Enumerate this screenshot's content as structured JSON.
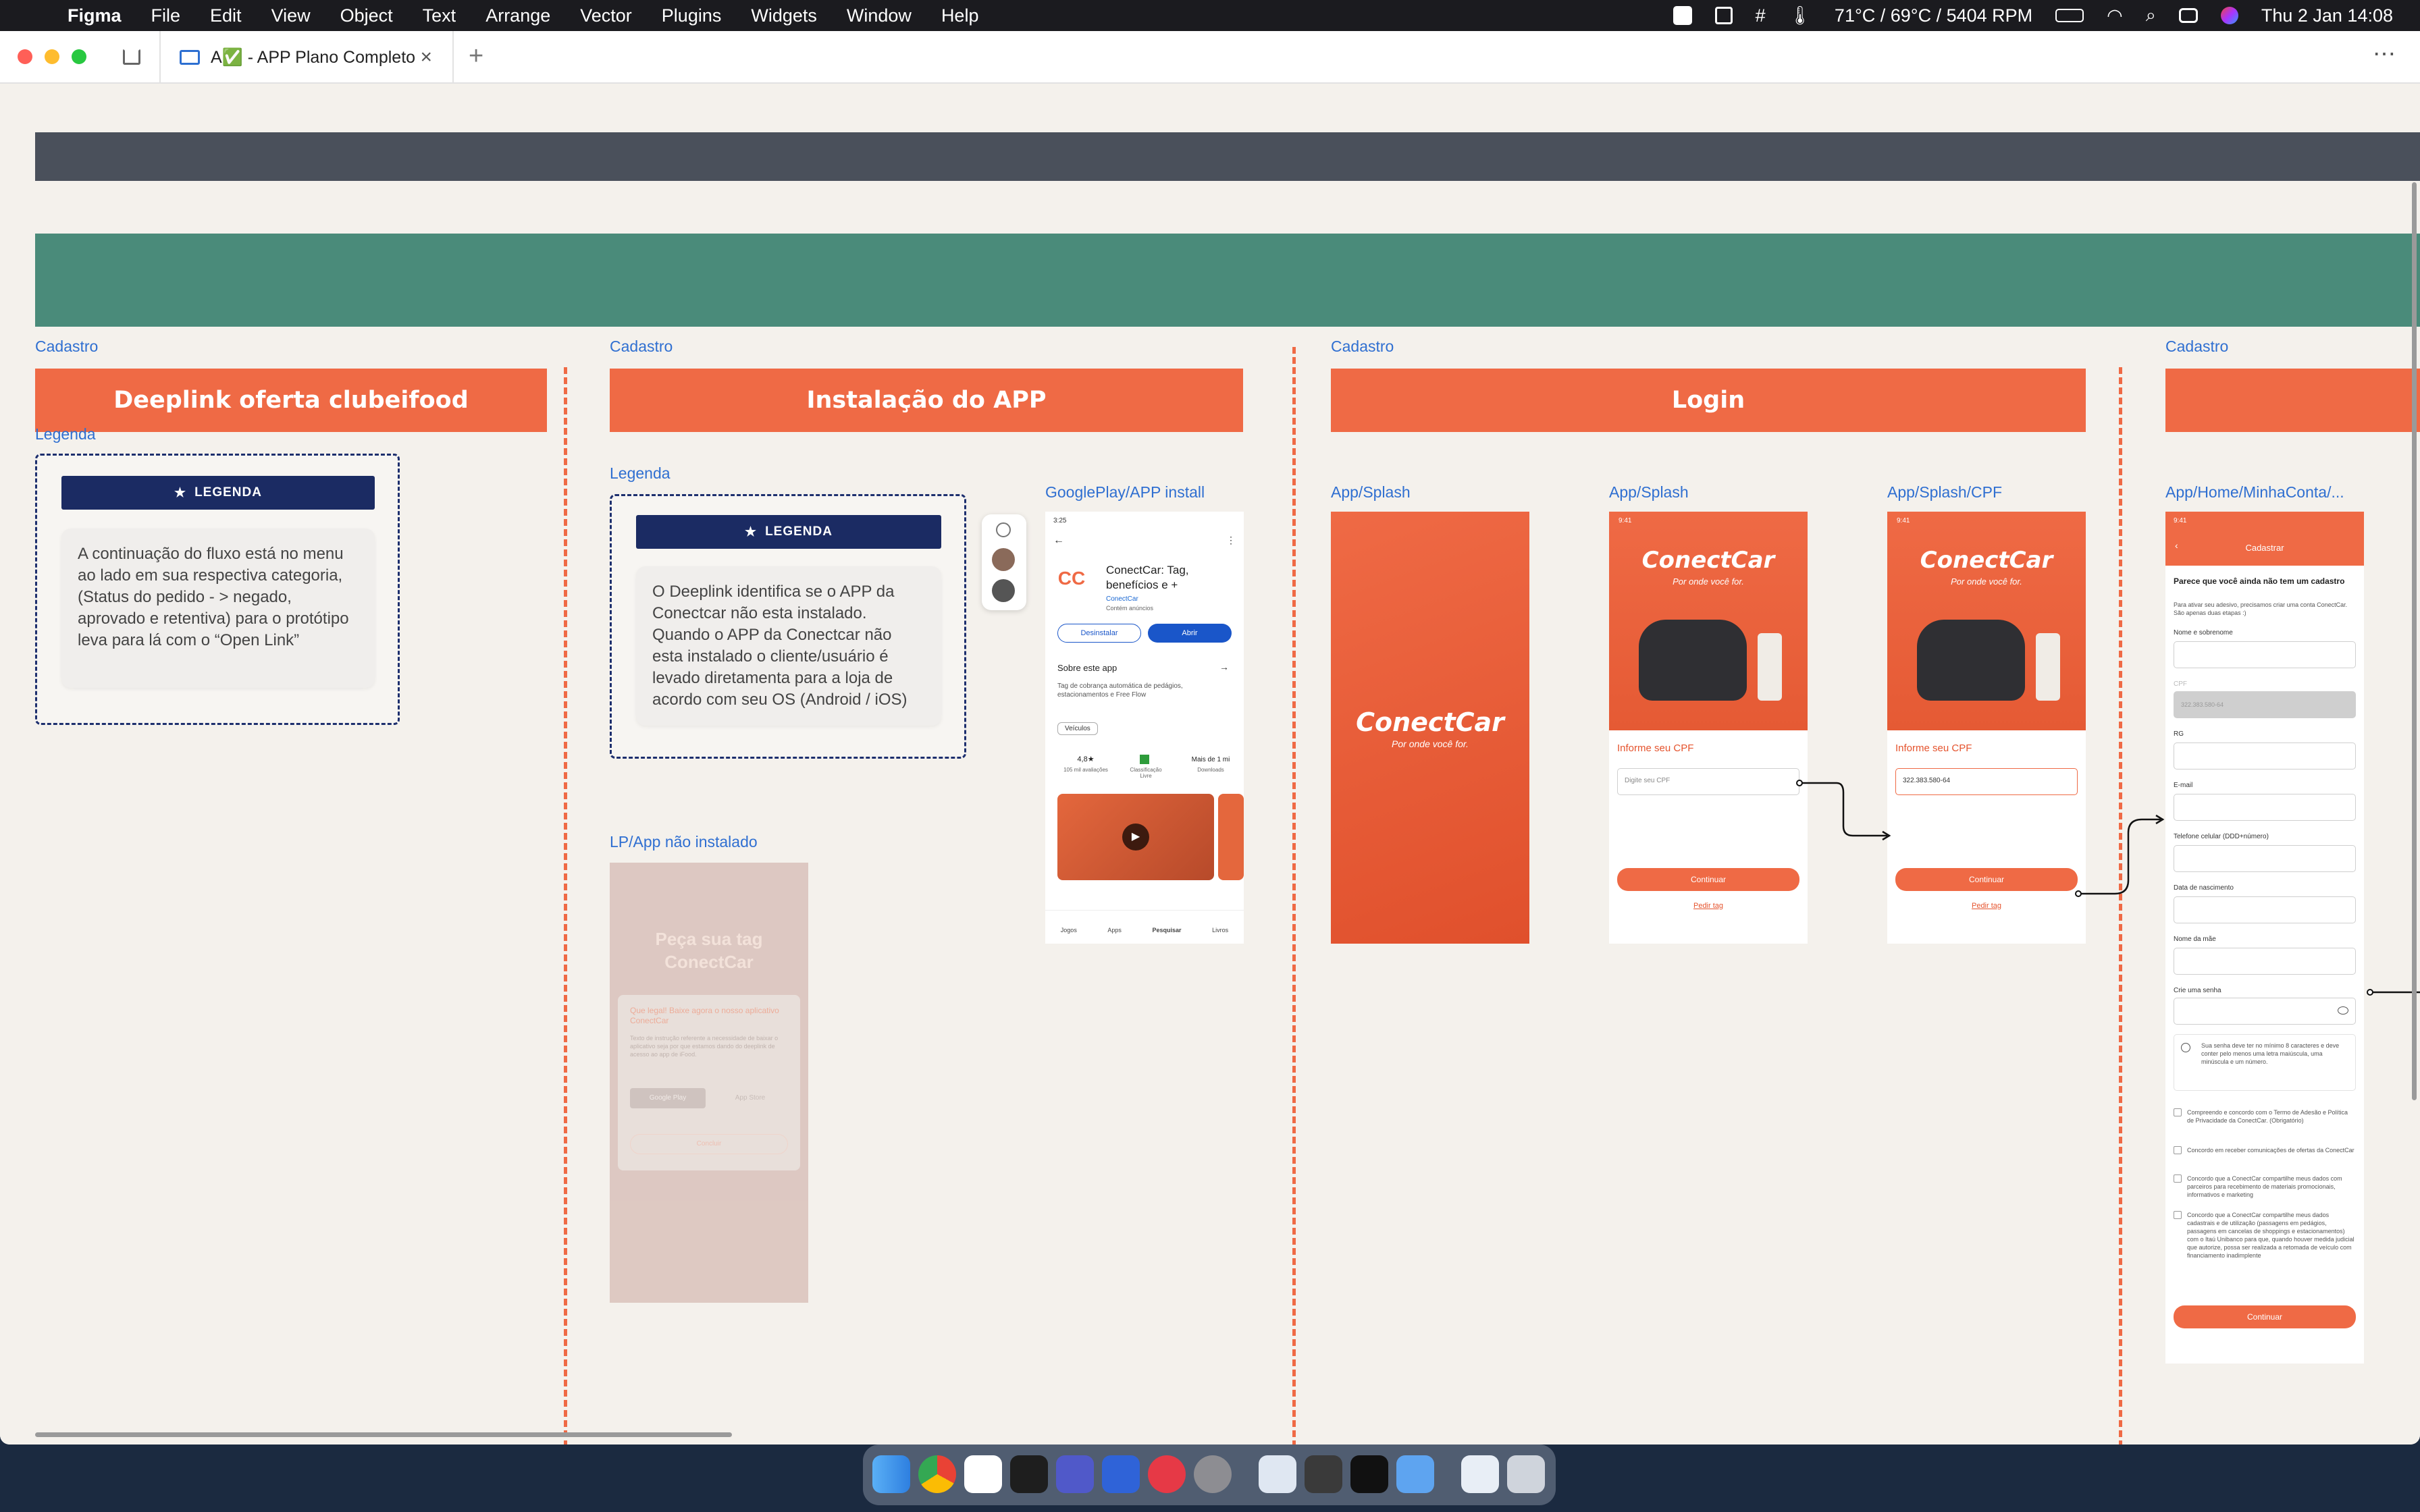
{
  "menubar": {
    "app": "Figma",
    "items": [
      "File",
      "Edit",
      "View",
      "Object",
      "Text",
      "Arrange",
      "Vector",
      "Plugins",
      "Widgets",
      "Window",
      "Help"
    ],
    "temp": "71°C / 69°C / 5404 RPM",
    "datetime": "Thu 2 Jan  14:08"
  },
  "tab": {
    "title": "A✅ - APP Plano Completo"
  },
  "sections": [
    {
      "category": "Cadastro",
      "title": "Deeplink oferta clubeifood",
      "legend_label": "Legenda",
      "legend_btn": "LEGENDA",
      "legend_text": "A continuação do fluxo está no menu ao lado em sua respectiva categoria, (Status do pedido - > negado, aprovado e retentiva) para o protótipo leva para lá com o “Open Link”"
    },
    {
      "category": "Cadastro",
      "title": "Instalação do APP",
      "legend_label": "Legenda",
      "legend_btn": "LEGENDA",
      "legend_text": "O Deeplink identifica se o APP da Conectcar não esta instalado. Quando o APP da Conectcar não esta instalado o cliente/usuário é levado diretamenta para a loja de acordo com seu OS (Android / iOS)"
    },
    {
      "category": "Cadastro",
      "title": "Login"
    },
    {
      "category": "Cadastro"
    }
  ],
  "frames": {
    "googleplay": {
      "label": "GooglePlay/APP install",
      "status": "3:25",
      "app_name": "ConectCar: Tag, benefícios e +",
      "publisher": "ConectCar",
      "ads": "Contém anúncios",
      "uninstall": "Desinstalar",
      "open": "Abrir",
      "about": "Sobre este app",
      "desc": "Tag de cobrança automática de pedágios, estacionamentos e Free Flow",
      "chip": "Veículos",
      "rating": "4,8★",
      "reviews": "105 mil avaliações",
      "classif": "Classificação Livre",
      "downloads": "Mais de 1 mi",
      "downloads_sub": "Downloads",
      "nav": [
        "Jogos",
        "Apps",
        "Pesquisar",
        "Livros"
      ]
    },
    "lp": {
      "label": "LP/App não instalado",
      "hero": "Peça sua tag ConectCar",
      "modal_title": "Que legal! Baixe agora o nosso aplicativo ConectCar",
      "modal_text": "Texto de instrução referente a necessidade de baixar o aplicativo seja por que estamos dando do deeplink de acesso ao app de iFood.",
      "gplay": "Google Play",
      "appstore": "App Store",
      "btn": "Concluir"
    },
    "splash1": {
      "label": "App/Splash",
      "logo": "ConectCar",
      "tagline": "Por onde você for."
    },
    "splash2": {
      "label": "App/Splash",
      "status": "9:41",
      "logo": "ConectCar",
      "tagline": "Por onde você for.",
      "heading": "Informe seu CPF",
      "placeholder": "Digite seu CPF",
      "btn": "Continuar",
      "link": "Pedir tag"
    },
    "splash3": {
      "label": "App/Splash/CPF",
      "status": "9:41",
      "logo": "ConectCar",
      "tagline": "Por onde você for.",
      "heading": "Informe seu CPF",
      "value": "322.383.580-64",
      "btn": "Continuar",
      "link": "Pedir tag"
    },
    "cadastro": {
      "label": "App/Home/MinhaConta/...",
      "status": "9:41",
      "title": "Cadastrar",
      "heading": "Parece que você ainda não tem um cadastro",
      "sub": "Para ativar seu adesivo, precisamos criar uma conta ConectCar. São apenas duas etapas :)",
      "fields": [
        "Nome e sobrenome",
        "CPF",
        "RG",
        "E-mail",
        "Telefone celular (DDD+número)",
        "Data de nascimento",
        "Nome da mãe",
        "Crie uma senha"
      ],
      "cpf_value": "322.383.580-64",
      "pw_hint": "Sua senha deve ter no mínimo 8 caracteres e deve conter pelo menos uma letra maiúscula, uma minúscula e um número.",
      "checks": [
        "Compreendo e concordo com o Termo de Adesão e Política de Privacidade da ConectCar. (Obrigatório)",
        "Concordo em receber comunicações de ofertas da ConectCar",
        "Concordo que a ConectCar compartilhe meus dados com parceiros para recebimento de materiais promocionais, informativos e marketing",
        "Concordo que a ConectCar compartilhe meus dados cadastrais e de utilização (passagens em pedágios, passagens em cancelas de shoppings e estacionamentos) com o Itaú Unibanco para que, quando houver medida judicial que autorize, possa ser realizada a retomada de veículo com financiamento inadimplente"
      ],
      "btn": "Continuar"
    }
  },
  "colors": {
    "accent": "#ef6a45",
    "green_bar": "#4a8b7a",
    "dark_bar": "#4a505b",
    "navy": "#1b2b63",
    "link_blue": "#2f6fd1"
  }
}
